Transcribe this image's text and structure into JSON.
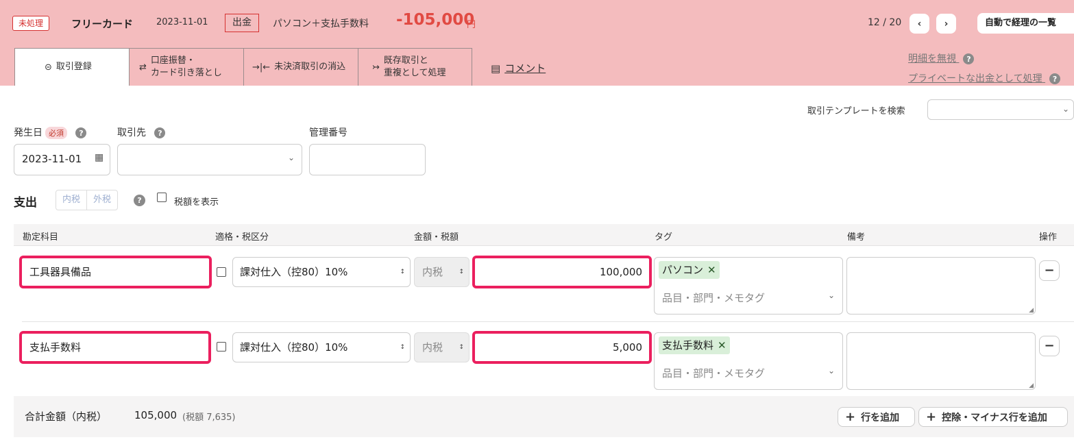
{
  "header": {
    "status": "未処理",
    "card_name": "フリーカード",
    "date": "2023-11-01",
    "direction": "出金",
    "description": "パソコン＋支払手数料",
    "amount": "-105,000",
    "currency": "円",
    "pager": "12 / 20",
    "list_button": "自動で経理の一覧",
    "accent_color": "#e14a43",
    "background_color": "#f4bcbe"
  },
  "tabs": [
    {
      "label": "取引登録",
      "icon": "minus-circle-icon",
      "active": true
    },
    {
      "label": "口座振替・\nカード引き落とし",
      "icon": "transfer-arrows-icon"
    },
    {
      "label": "未決済取引の消込",
      "icon": "settle-icon"
    },
    {
      "label": "既存取引と\n重複として処理",
      "icon": "merge-icon"
    }
  ],
  "comment_link": "コメント",
  "links": {
    "ignore": "明細を無視",
    "private": "プライベートな出金として処理"
  },
  "template": {
    "label": "取引テンプレートを検索",
    "value": ""
  },
  "form": {
    "date_label": "発生日",
    "required": "必須",
    "date_value": "2023-11-01",
    "partner_label": "取引先",
    "partner_value": "",
    "mgmt_label": "管理番号",
    "mgmt_value": ""
  },
  "expense": {
    "title": "支出",
    "tax_mode_inclusive": "内税",
    "tax_mode_exclusive": "外税",
    "show_tax_label": "税額を表示",
    "show_tax_checked": false
  },
  "table": {
    "headers": [
      "勘定科目",
      "適格・税区分",
      "金額・税額",
      "タグ",
      "備考",
      "操作"
    ],
    "rows": [
      {
        "account": "工具器具備品",
        "qualified": false,
        "tax_category": "課対仕入（控80）10%",
        "tax_inclusion": "内税",
        "amount": "100,000",
        "tag": "パソコン",
        "tag_placeholder": "品目・部門・メモタグ",
        "memo": ""
      },
      {
        "account": "支払手数料",
        "qualified": false,
        "tax_category": "課対仕入（控80）10%",
        "tax_inclusion": "内税",
        "amount": "5,000",
        "tag": "支払手数料",
        "tag_placeholder": "品目・部門・メモタグ",
        "memo": ""
      }
    ]
  },
  "footer": {
    "total_label": "合計金額（内税）",
    "total_value": "105,000",
    "total_tax": "(税額 7,635)",
    "add_row": "行を追加",
    "add_minus_row": "控除・マイナス行を追加"
  },
  "highlight_color": "#eb1f5e",
  "tag_color": "#d9efd9"
}
